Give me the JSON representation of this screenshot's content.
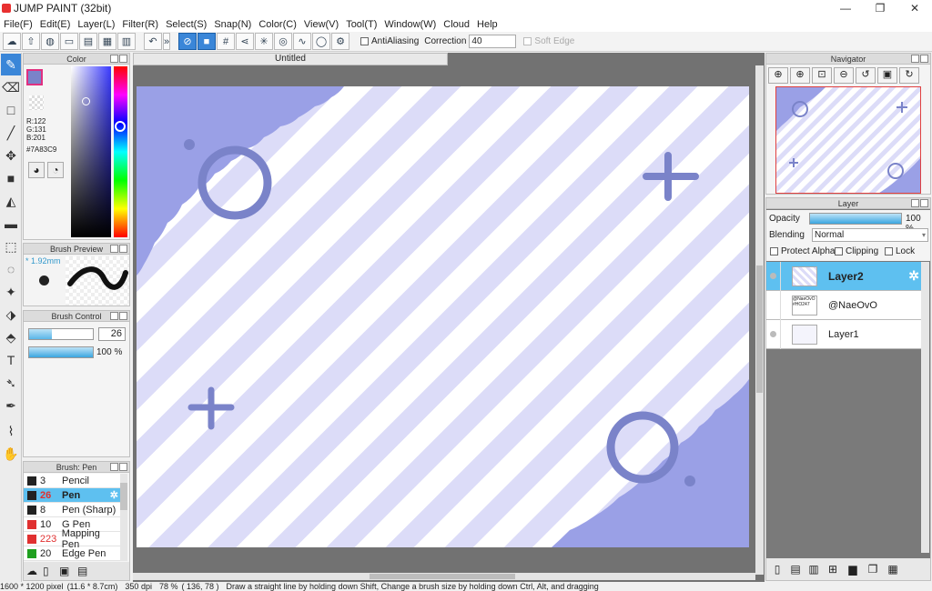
{
  "window": {
    "title": "JUMP PAINT (32bit)",
    "min": "—",
    "restore": "❐",
    "close": "✕"
  },
  "menu": [
    "File(F)",
    "Edit(E)",
    "Layer(L)",
    "Filter(R)",
    "Select(S)",
    "Snap(N)",
    "Color(C)",
    "View(V)",
    "Tool(T)",
    "Window(W)",
    "Cloud",
    "Help"
  ],
  "toolbar": {
    "antialiasing_label": "AntiAliasing",
    "correction_label": "Correction",
    "correction_value": "40",
    "soft_edge_label": "Soft Edge"
  },
  "color_panel": {
    "title": "Color",
    "r": "R:122",
    "g": "G:131",
    "b": "B:201",
    "hex": "#7A83C9",
    "current_color": "#7A83C9"
  },
  "brush_preview": {
    "title": "Brush Preview",
    "size": "* 1.92mm"
  },
  "brush_control": {
    "title": "Brush Control",
    "size_value": "26",
    "opacity_value": "100 %",
    "size_fraction": 0.35,
    "opacity_fraction": 1.0
  },
  "brush_list": {
    "title": "Brush: Pen",
    "items": [
      {
        "size": "3",
        "name": "Pencil",
        "color": "#222222"
      },
      {
        "size": "26",
        "name": "Pen",
        "color": "#222222"
      },
      {
        "size": "8",
        "name": "Pen (Sharp)",
        "color": "#222222"
      },
      {
        "size": "10",
        "name": "G Pen",
        "color": "#e03030"
      },
      {
        "size": "223",
        "name": "Mapping Pen",
        "color": "#e03030"
      },
      {
        "size": "20",
        "name": "Edge Pen",
        "color": "#20a020"
      }
    ]
  },
  "canvas": {
    "tab_title": "Untitled"
  },
  "navigator": {
    "title": "Navigator"
  },
  "layer_panel": {
    "title": "Layer",
    "opacity_label": "Opacity",
    "opacity_value": "100 %",
    "opacity_fraction": 1.0,
    "blending_label": "Blending",
    "blending_value": "Normal",
    "protect_alpha_label": "Protect Alpha",
    "clipping_label": "Clipping",
    "lock_label": "Lock",
    "layers": [
      {
        "name": "Layer2",
        "thumb_text": ""
      },
      {
        "name": "@NaeOvO",
        "thumb_text": "@NaeOvO #HO247"
      },
      {
        "name": "Layer1",
        "thumb_text": ""
      }
    ]
  },
  "status": {
    "size": "1600 * 1200 pixel",
    "physical": "(11.6 * 8.7cm)",
    "dpi": "350 dpi",
    "zoom": "78 %",
    "coords": "( 136, 78 )",
    "hint": "Draw a straight line by holding down Shift, Change a brush size by holding down Ctrl, Alt, and dragging"
  }
}
